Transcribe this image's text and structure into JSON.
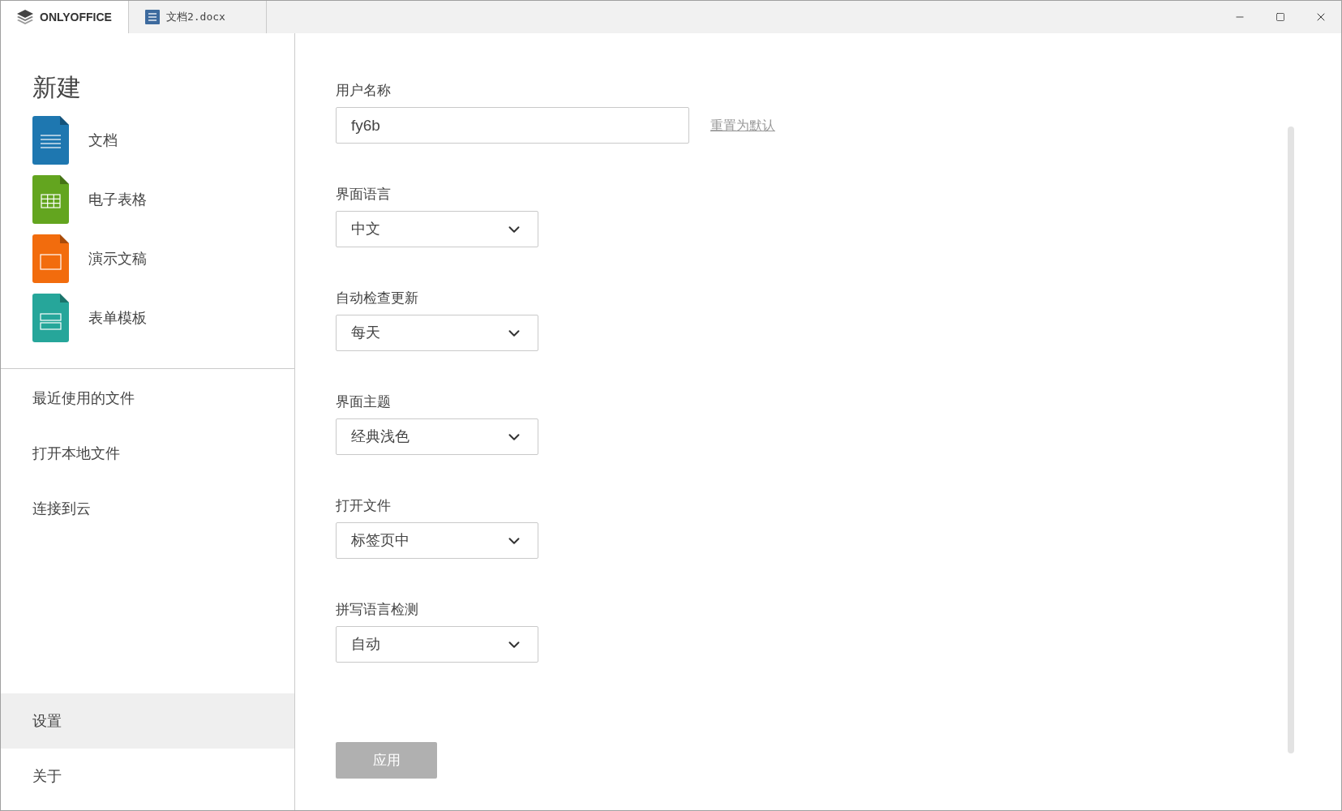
{
  "tabs": [
    {
      "kind": "brand",
      "label": "ONLYOFFICE",
      "selected": true
    },
    {
      "kind": "document",
      "label": "文档2.docx",
      "selected": false
    }
  ],
  "sidebar": {
    "new_title": "新建",
    "new_items": [
      {
        "kind": "document",
        "label": "文档"
      },
      {
        "kind": "spreadsheet",
        "label": "电子表格"
      },
      {
        "kind": "presentation",
        "label": "演示文稿"
      },
      {
        "kind": "form",
        "label": "表单模板"
      }
    ],
    "nav": [
      {
        "label": "最近使用的文件",
        "selected": false
      },
      {
        "label": "打开本地文件",
        "selected": false
      },
      {
        "label": "连接到云",
        "selected": false
      }
    ],
    "bottom_nav": [
      {
        "label": "设置",
        "selected": true
      },
      {
        "label": "关于",
        "selected": false
      }
    ]
  },
  "settings": [
    {
      "kind": "text",
      "label": "用户名称",
      "value": "fy6b",
      "link": "重置为默认"
    },
    {
      "kind": "select",
      "label": "界面语言",
      "value": "中文"
    },
    {
      "kind": "select",
      "label": "自动检查更新",
      "value": "每天"
    },
    {
      "kind": "select",
      "label": "界面主题",
      "value": "经典浅色"
    },
    {
      "kind": "select",
      "label": "打开文件",
      "value": "标签页中"
    },
    {
      "kind": "select",
      "label": "拼写语言检测",
      "value": "自动"
    }
  ],
  "apply_button": {
    "label": "应用",
    "disabled": true
  }
}
